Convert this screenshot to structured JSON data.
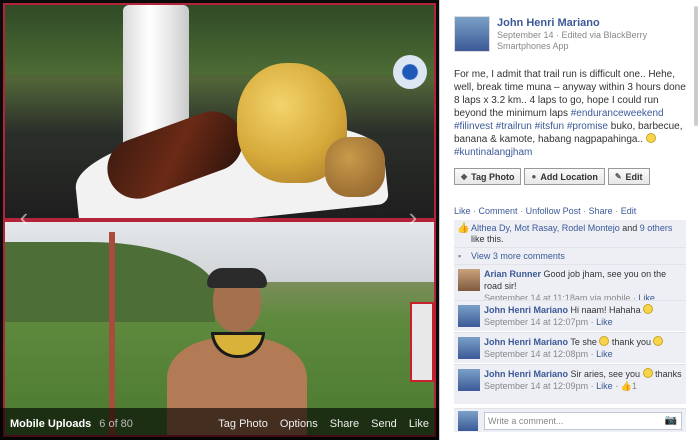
{
  "viewer": {
    "album": "Mobile Uploads",
    "position": "6 of 80",
    "actions": [
      "Tag Photo",
      "Options",
      "Share",
      "Send",
      "Like"
    ]
  },
  "post": {
    "owner_name": "John Henri Mariano",
    "meta": "September 14 · Edited via BlackBerry Smartphones App",
    "caption_text": "For me, I admit that trail run is difficult one.. Hehe, well, break time muna – anyway within 3 hours done 8 laps x 3.2 km.. 4 laps to go, hope I could run beyond the minimum laps ",
    "tags_line1": "#enduranceweekend #filinvest #trailrun #itsfun",
    "tags_prefix": "#promise",
    "caption_tail": " buko, barbecue, banana & kamote, habang nagpapahinga..",
    "tag_last": "#kuntinalangjham"
  },
  "buttons": {
    "tag_photo": "Tag Photo",
    "add_location": "Add Location",
    "edit": "Edit"
  },
  "links": {
    "like": "Like",
    "comment": "Comment",
    "unfollow": "Unfollow Post",
    "share": "Share",
    "edit": "Edit"
  },
  "likes": {
    "names": "Althea Dy, Mot Rasay, Rodel Montejo",
    "and_text": "and",
    "others": "9 others",
    "suffix": "like this."
  },
  "view_more": "View 3 more comments",
  "comments": [
    {
      "name": "Arian Runner",
      "text": "Good job jham, see you on the road sir!",
      "meta": "September 14 at 11:18am via mobile · ",
      "like": "Like"
    },
    {
      "name": "John Henri Mariano",
      "text": "Hi naam! Hahaha",
      "meta": "September 14 at 12:07pm · ",
      "like": "Like"
    },
    {
      "name": "John Henri Mariano",
      "text": "Te she",
      "text2": "thank you",
      "meta": "September 14 at 12:08pm · ",
      "like": "Like"
    },
    {
      "name": "John Henri Mariano",
      "text": "Sir aries, see you",
      "text2": "thanks",
      "meta": "September 14 at 12:09pm · ",
      "like": "Like",
      "like_count": "1"
    }
  ],
  "write_comment_placeholder": "Write a comment..."
}
